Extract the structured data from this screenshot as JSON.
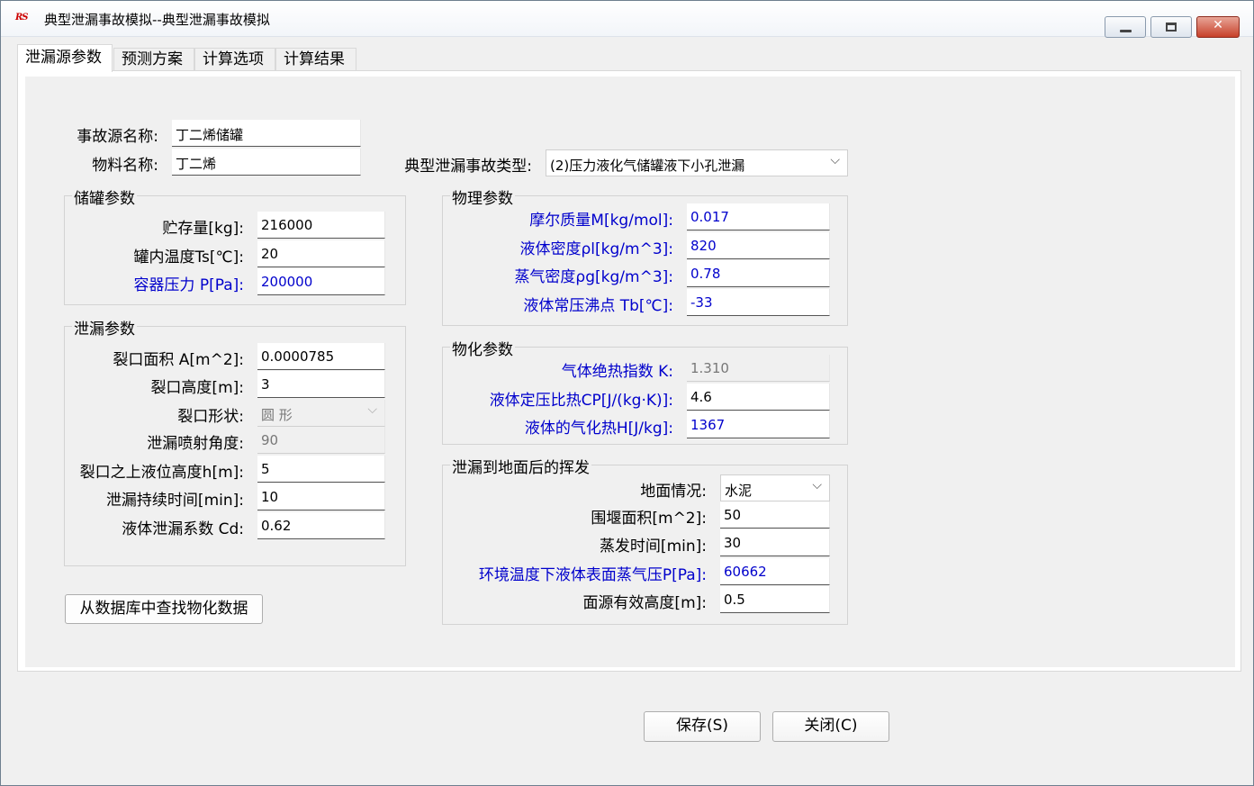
{
  "window": {
    "title": "典型泄漏事故模拟--典型泄漏事故模拟",
    "icon_text": "RS"
  },
  "tabs": [
    {
      "label": "泄漏源参数",
      "active": true
    },
    {
      "label": "预测方案",
      "active": false
    },
    {
      "label": "计算选项",
      "active": false
    },
    {
      "label": "计算结果",
      "active": false
    }
  ],
  "source": {
    "name_label": "事故源名称:",
    "name_value": "丁二烯储罐",
    "material_label": "物料名称:",
    "material_value": "丁二烯",
    "accident_type_label": "典型泄漏事故类型:",
    "accident_type_value": "(2)压力液化气储罐液下小孔泄漏"
  },
  "tank": {
    "title": "储罐参数",
    "storage_label": "贮存量[kg]:",
    "storage_value": "216000",
    "temp_label": "罐内温度Ts[℃]:",
    "temp_value": "20",
    "pressure_label": "容器压力 P[Pa]:",
    "pressure_value": "200000"
  },
  "leak": {
    "title": "泄漏参数",
    "area_label": "裂口面积 A[m^2]:",
    "area_value": "0.0000785",
    "height_label": "裂口高度[m]:",
    "height_value": "3",
    "shape_label": "裂口形状:",
    "shape_value": "圆 形",
    "angle_label": "泄漏喷射角度:",
    "angle_value": "90",
    "liquid_height_label": "裂口之上液位高度h[m]:",
    "liquid_height_value": "5",
    "duration_label": "泄漏持续时间[min]:",
    "duration_value": "10",
    "coef_label": "液体泄漏系数 Cd:",
    "coef_value": "0.62"
  },
  "physical": {
    "title": "物理参数",
    "molar_label": "摩尔质量M[kg/mol]:",
    "molar_value": "0.017",
    "liquid_density_label": "液体密度ρl[kg/m^3]:",
    "liquid_density_value": "820",
    "vapor_density_label": "蒸气密度ρg[kg/m^3]:",
    "vapor_density_value": "0.78",
    "boiling_label": "液体常压沸点 Tb[℃]:",
    "boiling_value": "-33"
  },
  "chemical": {
    "title": "物化参数",
    "adiabatic_label": "气体绝热指数 K:",
    "adiabatic_value": "1.310",
    "cp_label": "液体定压比热CP[J/(kg·K)]:",
    "cp_value": "4.6",
    "vap_heat_label": "液体的气化热H[J/kg]:",
    "vap_heat_value": "1367"
  },
  "evaporation": {
    "title": "泄漏到地面后的挥发",
    "ground_label": "地面情况:",
    "ground_value": "水泥",
    "dike_label": "围堰面积[m^2]:",
    "dike_value": "50",
    "time_label": "蒸发时间[min]:",
    "time_value": "30",
    "vapor_pressure_label": "环境温度下液体表面蒸气压P[Pa]:",
    "vapor_pressure_value": "60662",
    "source_height_label": "面源有效高度[m]:",
    "source_height_value": "0.5"
  },
  "buttons": {
    "lookup": "从数据库中查找物化数据",
    "save": "保存(S)",
    "close": "关闭(C)"
  },
  "colors": {
    "blue_label": "#0000cc",
    "background": "#f0f0f0"
  }
}
